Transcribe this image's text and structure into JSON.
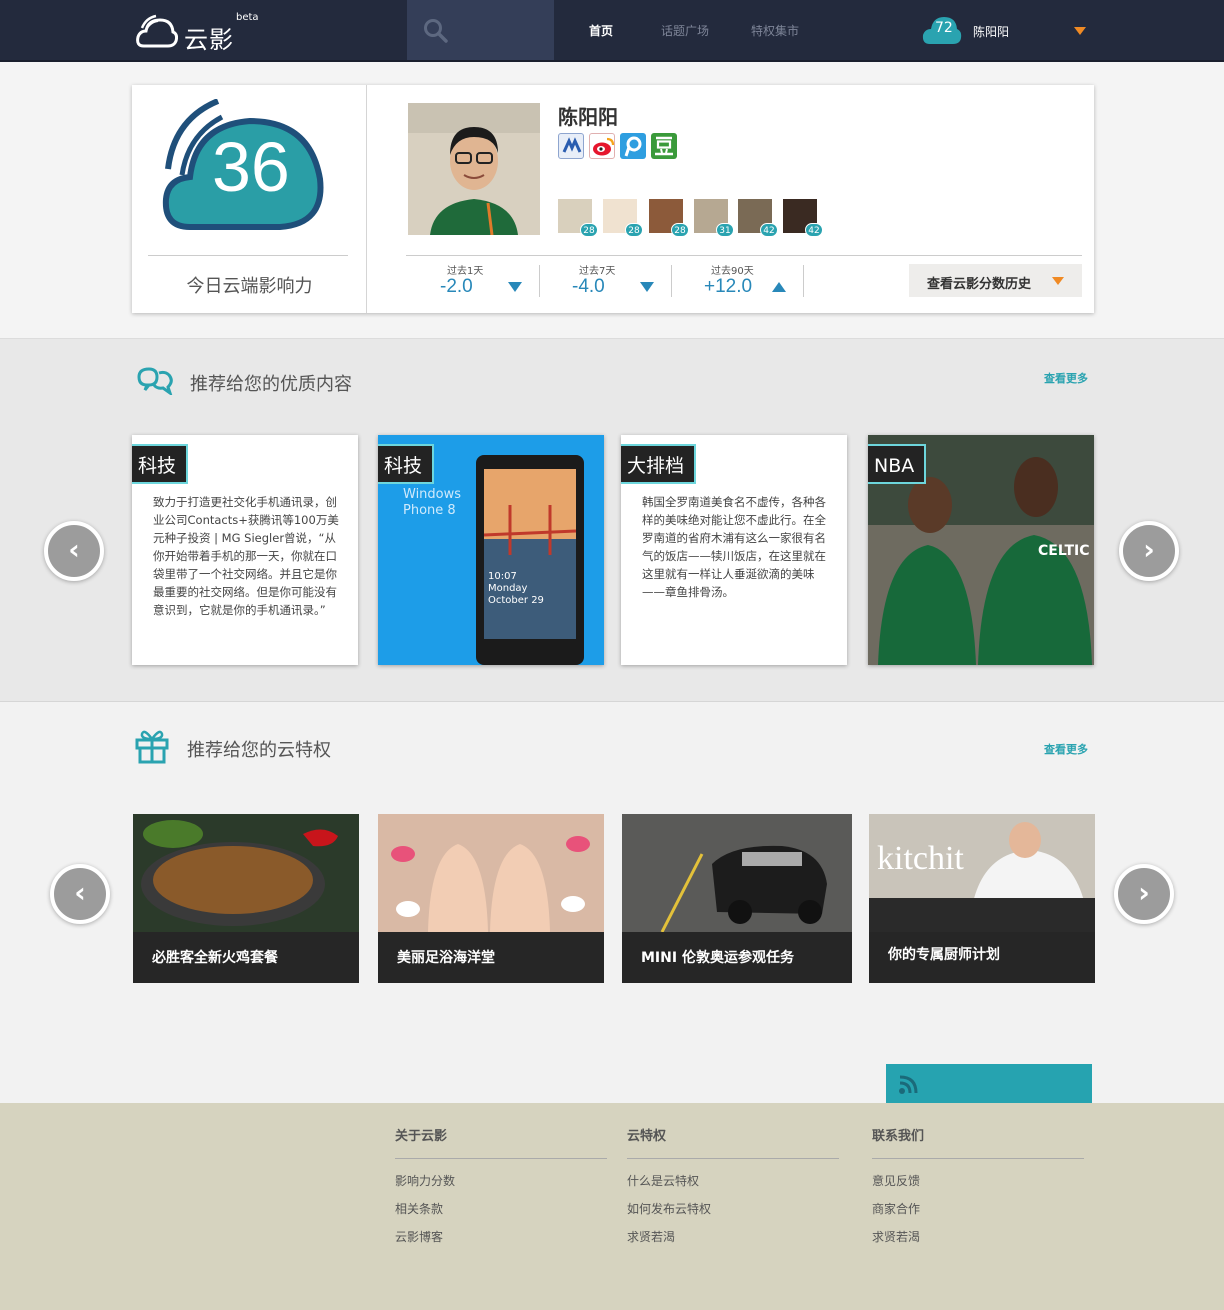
{
  "header": {
    "logo_text": "云影",
    "beta_label": "beta",
    "nav": [
      {
        "label": "首页",
        "active": true
      },
      {
        "label": "话题广场",
        "active": false
      },
      {
        "label": "特权集市",
        "active": false
      }
    ],
    "user_badge": "72",
    "user_name": "陈阳阳"
  },
  "profile": {
    "score": "36",
    "score_label": "今日云端影响力",
    "name": "陈阳阳",
    "social_icons": [
      "renren-icon",
      "weibo-icon",
      "tencent-weibo-icon",
      "douban-icon"
    ],
    "friends": [
      {
        "badge": "28"
      },
      {
        "badge": "28"
      },
      {
        "badge": "28"
      },
      {
        "badge": "31"
      },
      {
        "badge": "42"
      },
      {
        "badge": "42"
      }
    ],
    "stats": [
      {
        "label": "过去1天",
        "value": "-2.0",
        "trend": "down"
      },
      {
        "label": "过去7天",
        "value": "-4.0",
        "trend": "down"
      },
      {
        "label": "过去90天",
        "value": "+12.0",
        "trend": "up"
      }
    ],
    "history_button": "查看云影分数历史"
  },
  "content": {
    "title": "推荐给您的优质内容",
    "more": "查看更多",
    "prev": "‹",
    "next": "›",
    "cards": [
      {
        "tag": "科技",
        "text": "致力于打造更社交化手机通讯录，创业公司Contacts+获腾讯等100万美元种子投资 | MG Siegler曾说，“从你开始带着手机的那一天，你就在口袋里带了一个社交网络。并且它是你最重要的社交网络。但是你可能没有意识到，它就是你的手机通讯录。”"
      },
      {
        "tag": "科技",
        "phone_text": "Windows Phone 8",
        "lock_time": "10:07",
        "lock_day": "Monday",
        "lock_date": "October 29"
      },
      {
        "tag": "大排档",
        "text": "韩国全罗南道美食名不虚传，各种各样的美味绝对能让您不虚此行。在全罗南道的省府木浦有这么一家很有名气的饭店——犊川饭店，在这里就在这里就有一样让人垂涎欲滴的美味——章鱼排骨汤。"
      },
      {
        "tag": "NBA",
        "jersey": "CELTIC"
      }
    ]
  },
  "privileges": {
    "title": "推荐给您的云特权",
    "more": "查看更多",
    "prev": "‹",
    "next": "›",
    "items": [
      {
        "title": "必胜客全新火鸡套餐"
      },
      {
        "title": "美丽足浴海洋堂"
      },
      {
        "title": "MINI 伦敦奥运参观任务"
      },
      {
        "title": "你的专属厨师计划",
        "sign": "kitchit"
      }
    ]
  },
  "footer": {
    "columns": [
      {
        "heading": "关于云影",
        "links": [
          "影响力分数",
          "相关条款",
          "云影博客"
        ]
      },
      {
        "heading": "云特权",
        "links": [
          "什么是云特权",
          "如何发布云特权",
          "求贤若渴"
        ]
      },
      {
        "heading": "联系我们",
        "links": [
          "意见反馈",
          "商家合作",
          "求贤若渴"
        ]
      }
    ]
  },
  "colors": {
    "accent": "#2aa3b0",
    "header_bg": "#232a3d",
    "caret": "#f08a24",
    "stat_blue": "#2888b9"
  }
}
